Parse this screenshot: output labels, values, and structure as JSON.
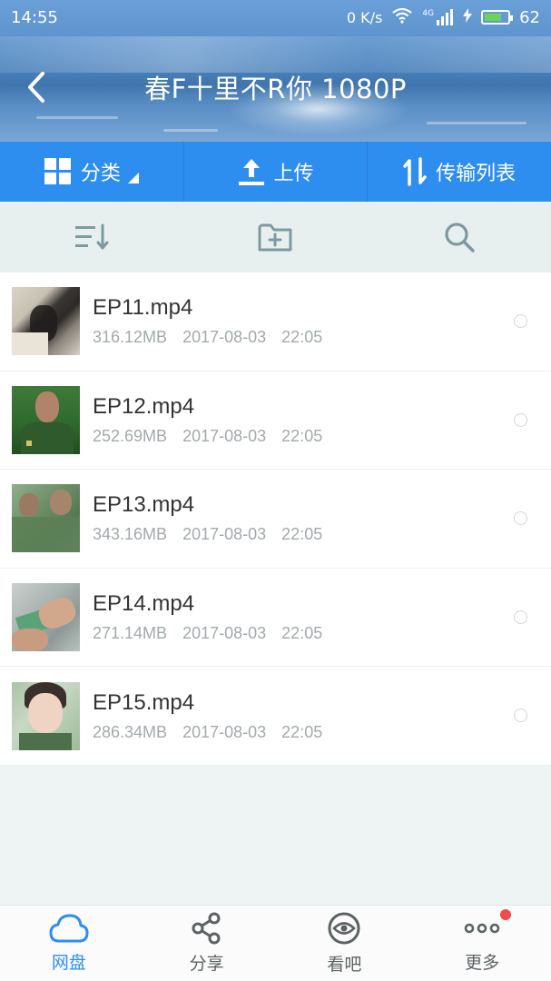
{
  "status_bar": {
    "time": "14:55",
    "network_speed": "0 K/s",
    "network_type": "4G",
    "battery_level": "62"
  },
  "header": {
    "title": "春F十里不R你 1080P"
  },
  "top_tabs": [
    {
      "label": "分类"
    },
    {
      "label": "上传"
    },
    {
      "label": "传输列表"
    }
  ],
  "files": [
    {
      "name": "EP11.mp4",
      "size": "316.12MB",
      "date": "2017-08-03",
      "time": "22:05"
    },
    {
      "name": "EP12.mp4",
      "size": "252.69MB",
      "date": "2017-08-03",
      "time": "22:05"
    },
    {
      "name": "EP13.mp4",
      "size": "343.16MB",
      "date": "2017-08-03",
      "time": "22:05"
    },
    {
      "name": "EP14.mp4",
      "size": "271.14MB",
      "date": "2017-08-03",
      "time": "22:05"
    },
    {
      "name": "EP15.mp4",
      "size": "286.34MB",
      "date": "2017-08-03",
      "time": "22:05"
    }
  ],
  "bottom_nav": [
    {
      "label": "网盘",
      "icon": "cloud-icon",
      "active": true
    },
    {
      "label": "分享",
      "icon": "share-icon",
      "active": false
    },
    {
      "label": "看吧",
      "icon": "eye-icon",
      "active": false
    },
    {
      "label": "更多",
      "icon": "more-icon",
      "active": false,
      "badge": true
    }
  ],
  "colors": {
    "accent": "#2e8ef0",
    "badge": "#f04a4a"
  }
}
